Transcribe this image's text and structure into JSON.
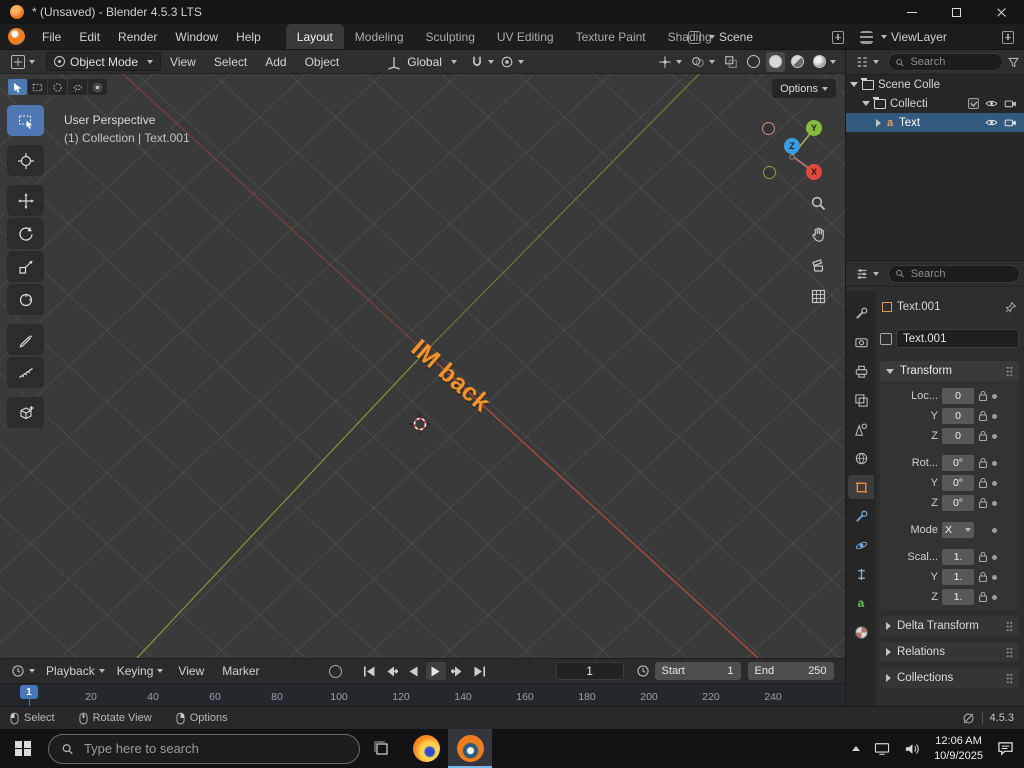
{
  "titlebar": {
    "title": "* (Unsaved) - Blender 4.5.3 LTS"
  },
  "topbar": {
    "menus": [
      "File",
      "Edit",
      "Render",
      "Window",
      "Help"
    ],
    "workspaces": [
      "Layout",
      "Modeling",
      "Sculpting",
      "UV Editing",
      "Texture Paint",
      "Shading"
    ],
    "scene_label": "Scene",
    "viewlayer_label": "ViewLayer"
  },
  "toolheader": {
    "mode": "Object Mode",
    "menus": [
      "View",
      "Select",
      "Add",
      "Object"
    ],
    "orientation": "Global"
  },
  "viewport": {
    "overlay_line1": "User Perspective",
    "overlay_line2": "(1) Collection | Text.001",
    "options_button": "Options",
    "text_object": "IM back",
    "axis_x": "X",
    "axis_y": "Y",
    "axis_z": "Z"
  },
  "outliner": {
    "search_placeholder": "Search",
    "rows": [
      {
        "label": "Scene Colle"
      },
      {
        "label": "Collecti"
      },
      {
        "label": "Text",
        "icon": "a"
      }
    ]
  },
  "properties": {
    "search_placeholder": "Search",
    "breadcrumb": "Text.001",
    "object_name": "Text.001",
    "transform_title": "Transform",
    "data_tab_icon": "a",
    "rows": [
      {
        "label": "Loc...",
        "value": "0"
      },
      {
        "label": "Y",
        "value": "0"
      },
      {
        "label": "Z",
        "value": "0"
      },
      {
        "label": "Rot...",
        "value": "0°"
      },
      {
        "label": "Y",
        "value": "0°"
      },
      {
        "label": "Z",
        "value": "0°"
      },
      {
        "label": "Mode",
        "value": "X"
      },
      {
        "label": "Scal...",
        "value": "1."
      },
      {
        "label": "Y",
        "value": "1."
      },
      {
        "label": "Z",
        "value": "1."
      }
    ],
    "sections": [
      "Delta Transform",
      "Relations",
      "Collections"
    ]
  },
  "timeline": {
    "menus": [
      "Playback",
      "Keying",
      "View",
      "Marker"
    ],
    "current_frame": "1",
    "start_label": "Start",
    "start_value": "1",
    "end_label": "End",
    "end_value": "250",
    "playhead_label": "1",
    "ticks": [
      "20",
      "40",
      "60",
      "80",
      "100",
      "120",
      "140",
      "160",
      "180",
      "200",
      "220",
      "240"
    ]
  },
  "statusbar": {
    "items": [
      "Select",
      "Rotate View",
      "Options"
    ],
    "version": "4.5.3"
  },
  "taskbar": {
    "search_placeholder": "Type here to search",
    "time": "12:06 AM",
    "date": "10/9/2025"
  }
}
